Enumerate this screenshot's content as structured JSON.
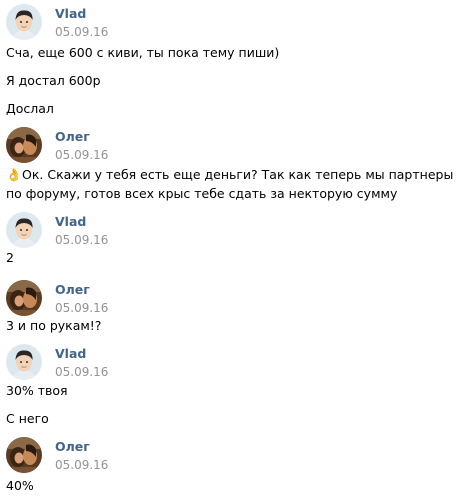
{
  "messages": [
    {
      "author": "Vlad",
      "date": "05.09.16",
      "avatar": "vlad-avatar",
      "lines": [
        "Сча, еще 600 с киви, ты пока тему пиши)",
        "Я достал 600р",
        "Дослал"
      ]
    },
    {
      "author": "Олег",
      "date": "05.09.16",
      "avatar": "oleg-avatar",
      "emoji": "👌",
      "lines": [
        "Ок. Скажи у тебя есть еще деньги? Так как теперь мы партнеры по форуму, готов всех крыс тебе сдать за некторую сумму"
      ]
    },
    {
      "author": "Vlad",
      "date": "05.09.16",
      "avatar": "vlad-avatar",
      "lines": [
        "2"
      ]
    },
    {
      "author": "Олег",
      "date": "05.09.16",
      "avatar": "oleg-avatar",
      "lines": [
        "3 и по рукам!?"
      ]
    },
    {
      "author": "Vlad",
      "date": "05.09.16",
      "avatar": "vlad-avatar",
      "lines": [
        "30% твоя",
        "С него"
      ]
    },
    {
      "author": "Олег",
      "date": "05.09.16",
      "avatar": "oleg-avatar",
      "lines": [
        "40%"
      ]
    }
  ],
  "colors": {
    "author": "#42648b",
    "date": "#939393",
    "text": "#000000"
  }
}
